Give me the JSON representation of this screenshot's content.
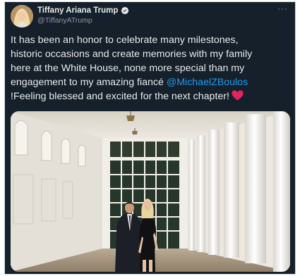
{
  "tweet": {
    "display_name": "Tiffany Ariana Trump",
    "handle": "@TiffanyATrump",
    "more_label": "···",
    "text_lines": [
      "It has been an honor to celebrate many milestones,",
      "historic occasions and create memories with my family",
      "here at the White House, none more special than my"
    ],
    "line4_text": "engagement to my amazing fiancé ",
    "mention": "@MichaelZBoulos",
    "line5_text": "!Feeling blessed and excited for the next chapter!",
    "heart_icon": "red-heart-icon",
    "verified_icon": "verified-badge-icon",
    "photo_icon": "photo-colonnade-couple"
  },
  "colors": {
    "background": "#15202b",
    "text": "#e7e9ea",
    "secondary": "#8b98a5",
    "link": "#1d9bf0",
    "heart": "#e0245e"
  }
}
